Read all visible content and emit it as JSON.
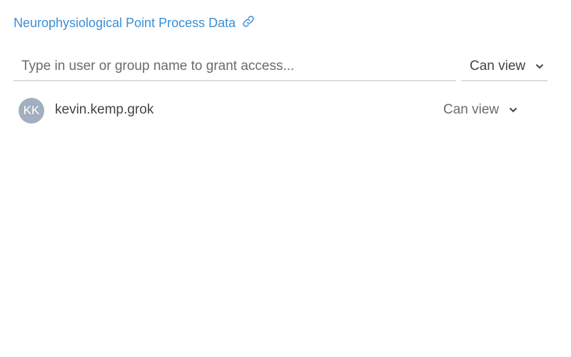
{
  "header": {
    "title": "Neurophysiological Point Process Data",
    "icon": "link-icon"
  },
  "share": {
    "placeholder": "Type in user or group name to grant access...",
    "value": "",
    "permission": "Can view"
  },
  "users": [
    {
      "initials": "KK",
      "name": "kevin.kemp.grok",
      "permission": "Can view",
      "avatar_color": "#a2afbf"
    }
  ],
  "colors": {
    "accent": "#3a8fd6"
  }
}
